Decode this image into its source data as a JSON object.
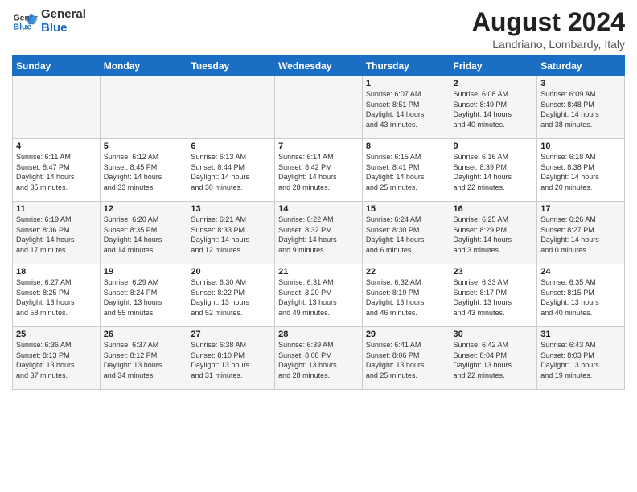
{
  "logo": {
    "line1": "General",
    "line2": "Blue"
  },
  "title": "August 2024",
  "subtitle": "Landriano, Lombardy, Italy",
  "headers": [
    "Sunday",
    "Monday",
    "Tuesday",
    "Wednesday",
    "Thursday",
    "Friday",
    "Saturday"
  ],
  "weeks": [
    [
      {
        "day": "",
        "info": ""
      },
      {
        "day": "",
        "info": ""
      },
      {
        "day": "",
        "info": ""
      },
      {
        "day": "",
        "info": ""
      },
      {
        "day": "1",
        "info": "Sunrise: 6:07 AM\nSunset: 8:51 PM\nDaylight: 14 hours\nand 43 minutes."
      },
      {
        "day": "2",
        "info": "Sunrise: 6:08 AM\nSunset: 8:49 PM\nDaylight: 14 hours\nand 40 minutes."
      },
      {
        "day": "3",
        "info": "Sunrise: 6:09 AM\nSunset: 8:48 PM\nDaylight: 14 hours\nand 38 minutes."
      }
    ],
    [
      {
        "day": "4",
        "info": "Sunrise: 6:11 AM\nSunset: 8:47 PM\nDaylight: 14 hours\nand 35 minutes."
      },
      {
        "day": "5",
        "info": "Sunrise: 6:12 AM\nSunset: 8:45 PM\nDaylight: 14 hours\nand 33 minutes."
      },
      {
        "day": "6",
        "info": "Sunrise: 6:13 AM\nSunset: 8:44 PM\nDaylight: 14 hours\nand 30 minutes."
      },
      {
        "day": "7",
        "info": "Sunrise: 6:14 AM\nSunset: 8:42 PM\nDaylight: 14 hours\nand 28 minutes."
      },
      {
        "day": "8",
        "info": "Sunrise: 6:15 AM\nSunset: 8:41 PM\nDaylight: 14 hours\nand 25 minutes."
      },
      {
        "day": "9",
        "info": "Sunrise: 6:16 AM\nSunset: 8:39 PM\nDaylight: 14 hours\nand 22 minutes."
      },
      {
        "day": "10",
        "info": "Sunrise: 6:18 AM\nSunset: 8:38 PM\nDaylight: 14 hours\nand 20 minutes."
      }
    ],
    [
      {
        "day": "11",
        "info": "Sunrise: 6:19 AM\nSunset: 8:36 PM\nDaylight: 14 hours\nand 17 minutes."
      },
      {
        "day": "12",
        "info": "Sunrise: 6:20 AM\nSunset: 8:35 PM\nDaylight: 14 hours\nand 14 minutes."
      },
      {
        "day": "13",
        "info": "Sunrise: 6:21 AM\nSunset: 8:33 PM\nDaylight: 14 hours\nand 12 minutes."
      },
      {
        "day": "14",
        "info": "Sunrise: 6:22 AM\nSunset: 8:32 PM\nDaylight: 14 hours\nand 9 minutes."
      },
      {
        "day": "15",
        "info": "Sunrise: 6:24 AM\nSunset: 8:30 PM\nDaylight: 14 hours\nand 6 minutes."
      },
      {
        "day": "16",
        "info": "Sunrise: 6:25 AM\nSunset: 8:29 PM\nDaylight: 14 hours\nand 3 minutes."
      },
      {
        "day": "17",
        "info": "Sunrise: 6:26 AM\nSunset: 8:27 PM\nDaylight: 14 hours\nand 0 minutes."
      }
    ],
    [
      {
        "day": "18",
        "info": "Sunrise: 6:27 AM\nSunset: 8:25 PM\nDaylight: 13 hours\nand 58 minutes."
      },
      {
        "day": "19",
        "info": "Sunrise: 6:29 AM\nSunset: 8:24 PM\nDaylight: 13 hours\nand 55 minutes."
      },
      {
        "day": "20",
        "info": "Sunrise: 6:30 AM\nSunset: 8:22 PM\nDaylight: 13 hours\nand 52 minutes."
      },
      {
        "day": "21",
        "info": "Sunrise: 6:31 AM\nSunset: 8:20 PM\nDaylight: 13 hours\nand 49 minutes."
      },
      {
        "day": "22",
        "info": "Sunrise: 6:32 AM\nSunset: 8:19 PM\nDaylight: 13 hours\nand 46 minutes."
      },
      {
        "day": "23",
        "info": "Sunrise: 6:33 AM\nSunset: 8:17 PM\nDaylight: 13 hours\nand 43 minutes."
      },
      {
        "day": "24",
        "info": "Sunrise: 6:35 AM\nSunset: 8:15 PM\nDaylight: 13 hours\nand 40 minutes."
      }
    ],
    [
      {
        "day": "25",
        "info": "Sunrise: 6:36 AM\nSunset: 8:13 PM\nDaylight: 13 hours\nand 37 minutes."
      },
      {
        "day": "26",
        "info": "Sunrise: 6:37 AM\nSunset: 8:12 PM\nDaylight: 13 hours\nand 34 minutes."
      },
      {
        "day": "27",
        "info": "Sunrise: 6:38 AM\nSunset: 8:10 PM\nDaylight: 13 hours\nand 31 minutes."
      },
      {
        "day": "28",
        "info": "Sunrise: 6:39 AM\nSunset: 8:08 PM\nDaylight: 13 hours\nand 28 minutes."
      },
      {
        "day": "29",
        "info": "Sunrise: 6:41 AM\nSunset: 8:06 PM\nDaylight: 13 hours\nand 25 minutes."
      },
      {
        "day": "30",
        "info": "Sunrise: 6:42 AM\nSunset: 8:04 PM\nDaylight: 13 hours\nand 22 minutes."
      },
      {
        "day": "31",
        "info": "Sunrise: 6:43 AM\nSunset: 8:03 PM\nDaylight: 13 hours\nand 19 minutes."
      }
    ]
  ]
}
